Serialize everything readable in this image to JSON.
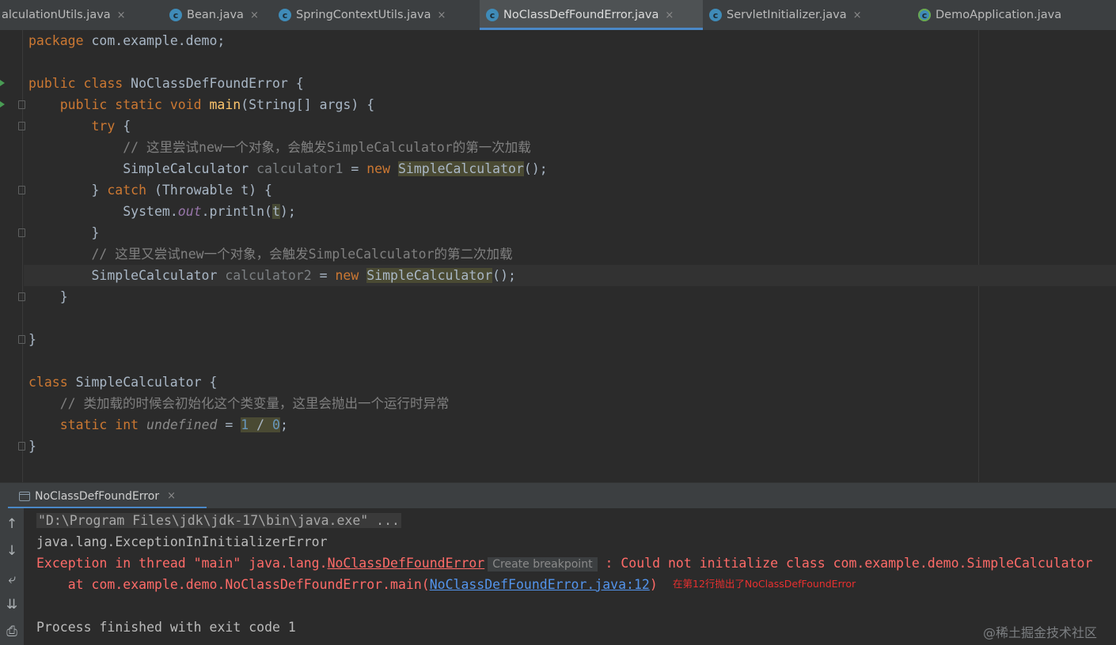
{
  "tabs": [
    {
      "label": "alculationUtils.java",
      "icon": "java-class-icon",
      "active": false
    },
    {
      "label": "Bean.java",
      "icon": "java-class-icon",
      "active": false
    },
    {
      "label": "SpringContextUtils.java",
      "icon": "java-class-icon",
      "active": false
    },
    {
      "label": "NoClassDefFoundError.java",
      "icon": "java-class-icon",
      "active": true
    },
    {
      "label": "ServletInitializer.java",
      "icon": "java-class-icon",
      "active": false
    },
    {
      "label": "DemoApplication.java",
      "icon": "spring-boot-class-icon",
      "active": false
    }
  ],
  "tab_icon_letter": "c",
  "close_glyph": "×",
  "code": {
    "line1": {
      "kw": "package",
      "rest": " com.example.demo;"
    },
    "line3": {
      "kw": "public class",
      "rest": " NoClassDefFoundError {"
    },
    "line4": {
      "indent": "    ",
      "kw": "public static void",
      "sp": " ",
      "fn": "main",
      "rest": "(String[] args) {"
    },
    "line5": {
      "indent": "        ",
      "kw": "try",
      "rest": " {"
    },
    "line6": {
      "indent": "            ",
      "comment": "// 这里尝试new一个对象，会触发SimpleCalculator的第一次加载"
    },
    "line7": {
      "indent": "            ",
      "type": "SimpleCalculator ",
      "var": "calculator1",
      "eq": " = ",
      "kw": "new",
      "sp": " ",
      "ctor": "SimpleCalculator",
      "rest": "();"
    },
    "line8": {
      "indent": "        ",
      "pre": "} ",
      "kw": "catch",
      "rest": " (Throwable t) {"
    },
    "line9": {
      "indent": "            ",
      "pre": "System.",
      "field": "out",
      "mid": ".println(",
      "arg": "t",
      "rest": ");"
    },
    "line10": {
      "text": "        }"
    },
    "line11": {
      "indent": "        ",
      "comment": "// 这里又尝试new一个对象，会触发SimpleCalculator的第二次加载"
    },
    "line12": {
      "indent": "        ",
      "type": "SimpleCalculator ",
      "var": "calculator2",
      "eq": " = ",
      "kw": "new",
      "sp": " ",
      "ctor": "SimpleCalculator",
      "rest": "();"
    },
    "line13": {
      "text": "    }"
    },
    "line15": {
      "text": "}"
    },
    "line17": {
      "kw": "class",
      "rest": " SimpleCalculator {"
    },
    "line18": {
      "indent": "    ",
      "comment": "// 类加载的时候会初始化这个类变量，这里会抛出一个运行时异常"
    },
    "line19": {
      "indent": "    ",
      "kw": "static int",
      "sp": " ",
      "field": "undefined",
      "eq": " = ",
      "num1": "1",
      "op": " / ",
      "num2": "0",
      "rest": ";"
    },
    "line20": {
      "text": "}"
    }
  },
  "run_panel": {
    "tab_label": "NoClassDefFoundError",
    "toolbar": {
      "up": "↑",
      "down": "↓",
      "wrap": "⤶",
      "scroll_end": "⇊",
      "print": "⎙"
    },
    "console": {
      "cmd": "\"D:\\Program Files\\jdk\\jdk-17\\bin\\java.exe\" ...",
      "line2": "java.lang.ExceptionInInitializerError",
      "line3": {
        "pre": "Exception in thread \"main\" java.lang.",
        "link": "NoClassDefFoundError",
        "popup": "Create breakpoint",
        "post": " : Could not initialize class com.example.demo.SimpleCalculator"
      },
      "line4": {
        "pre": "    at com.example.demo.NoClassDefFoundError.main(",
        "link": "NoClassDefFoundError.java:12",
        "post": ")"
      },
      "annotation": "在第12行抛出了NoClassDefFoundError",
      "exit": "Process finished with exit code 1"
    },
    "watermark": "@稀土掘金技术社区"
  }
}
